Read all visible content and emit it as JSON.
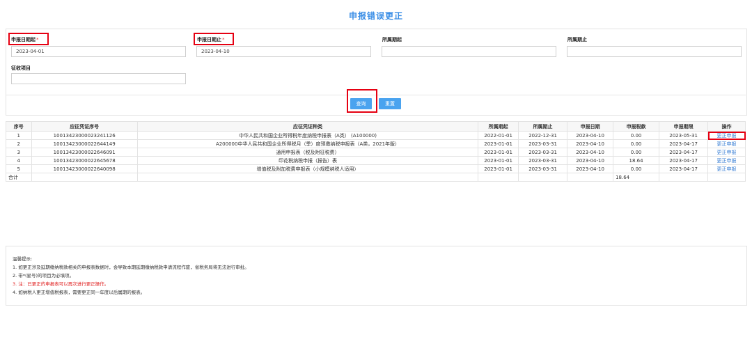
{
  "page": {
    "title": "申报错误更正"
  },
  "form": {
    "start_date": {
      "label": "申报日期起",
      "required": "*",
      "value": "2023-04-01"
    },
    "end_date": {
      "label": "申报日期止",
      "required": "*",
      "value": "2023-04-10"
    },
    "period_start": {
      "label": "所属期起",
      "value": ""
    },
    "period_end": {
      "label": "所属期止",
      "value": ""
    },
    "item": {
      "label": "征收项目",
      "value": ""
    },
    "query_label": "查询",
    "reset_label": "重置"
  },
  "table": {
    "headers": [
      "序号",
      "应征凭证序号",
      "应征凭证种类",
      "所属期起",
      "所属期止",
      "申报日期",
      "申报税款",
      "申报期限",
      "操作"
    ],
    "rows": [
      [
        "1",
        "10013423000023241126",
        "中华人民共和国企业所得税年度纳税申报表（A类） (A100000)",
        "2022-01-01",
        "2022-12-31",
        "2023-04-10",
        "0.00",
        "2023-05-31",
        "更正申报"
      ],
      [
        "2",
        "10013423000022644149",
        "A200000中华人民共和国企业所得税月（季）度预缴纳税申报表（A类，2021年版）",
        "2023-01-01",
        "2023-03-31",
        "2023-04-10",
        "0.00",
        "2023-04-17",
        "更正申报"
      ],
      [
        "3",
        "10013423000022646091",
        "通用申报表（税及附征税费）",
        "2023-01-01",
        "2023-03-31",
        "2023-04-10",
        "0.00",
        "2023-04-17",
        "更正申报"
      ],
      [
        "4",
        "10013423000022645678",
        "印花税纳税申报（报告）表",
        "2023-01-01",
        "2023-03-31",
        "2023-04-10",
        "18.64",
        "2023-04-17",
        "更正申报"
      ],
      [
        "5",
        "10013423000022640098",
        "增值税及附加税费申报表（小规模纳税人适用）",
        "2023-01-01",
        "2023-03-31",
        "2023-04-10",
        "0.00",
        "2023-04-17",
        "更正申报"
      ]
    ],
    "total": {
      "label": "合计",
      "tax": "18.64"
    }
  },
  "tips": {
    "heading": "温馨提示:",
    "lines": [
      "1. 如更正涉及延期缴纳税款相关的申报表数据时，会导致本期延期缴纳税款申请流程作废，省税务局将无法进行审批。",
      "2. 带*(星号)的项目为必填项。",
      "3. 注：已更正的申报表可以再次进行更正操作。",
      "4. 如纳税人更正增值税报表，需要更正同一年度以后属期的报表。"
    ]
  },
  "colors": {
    "accent": "#3a8ee6",
    "button": "#4aa3ef",
    "highlight": "#e60012",
    "warning": "#e02020"
  }
}
